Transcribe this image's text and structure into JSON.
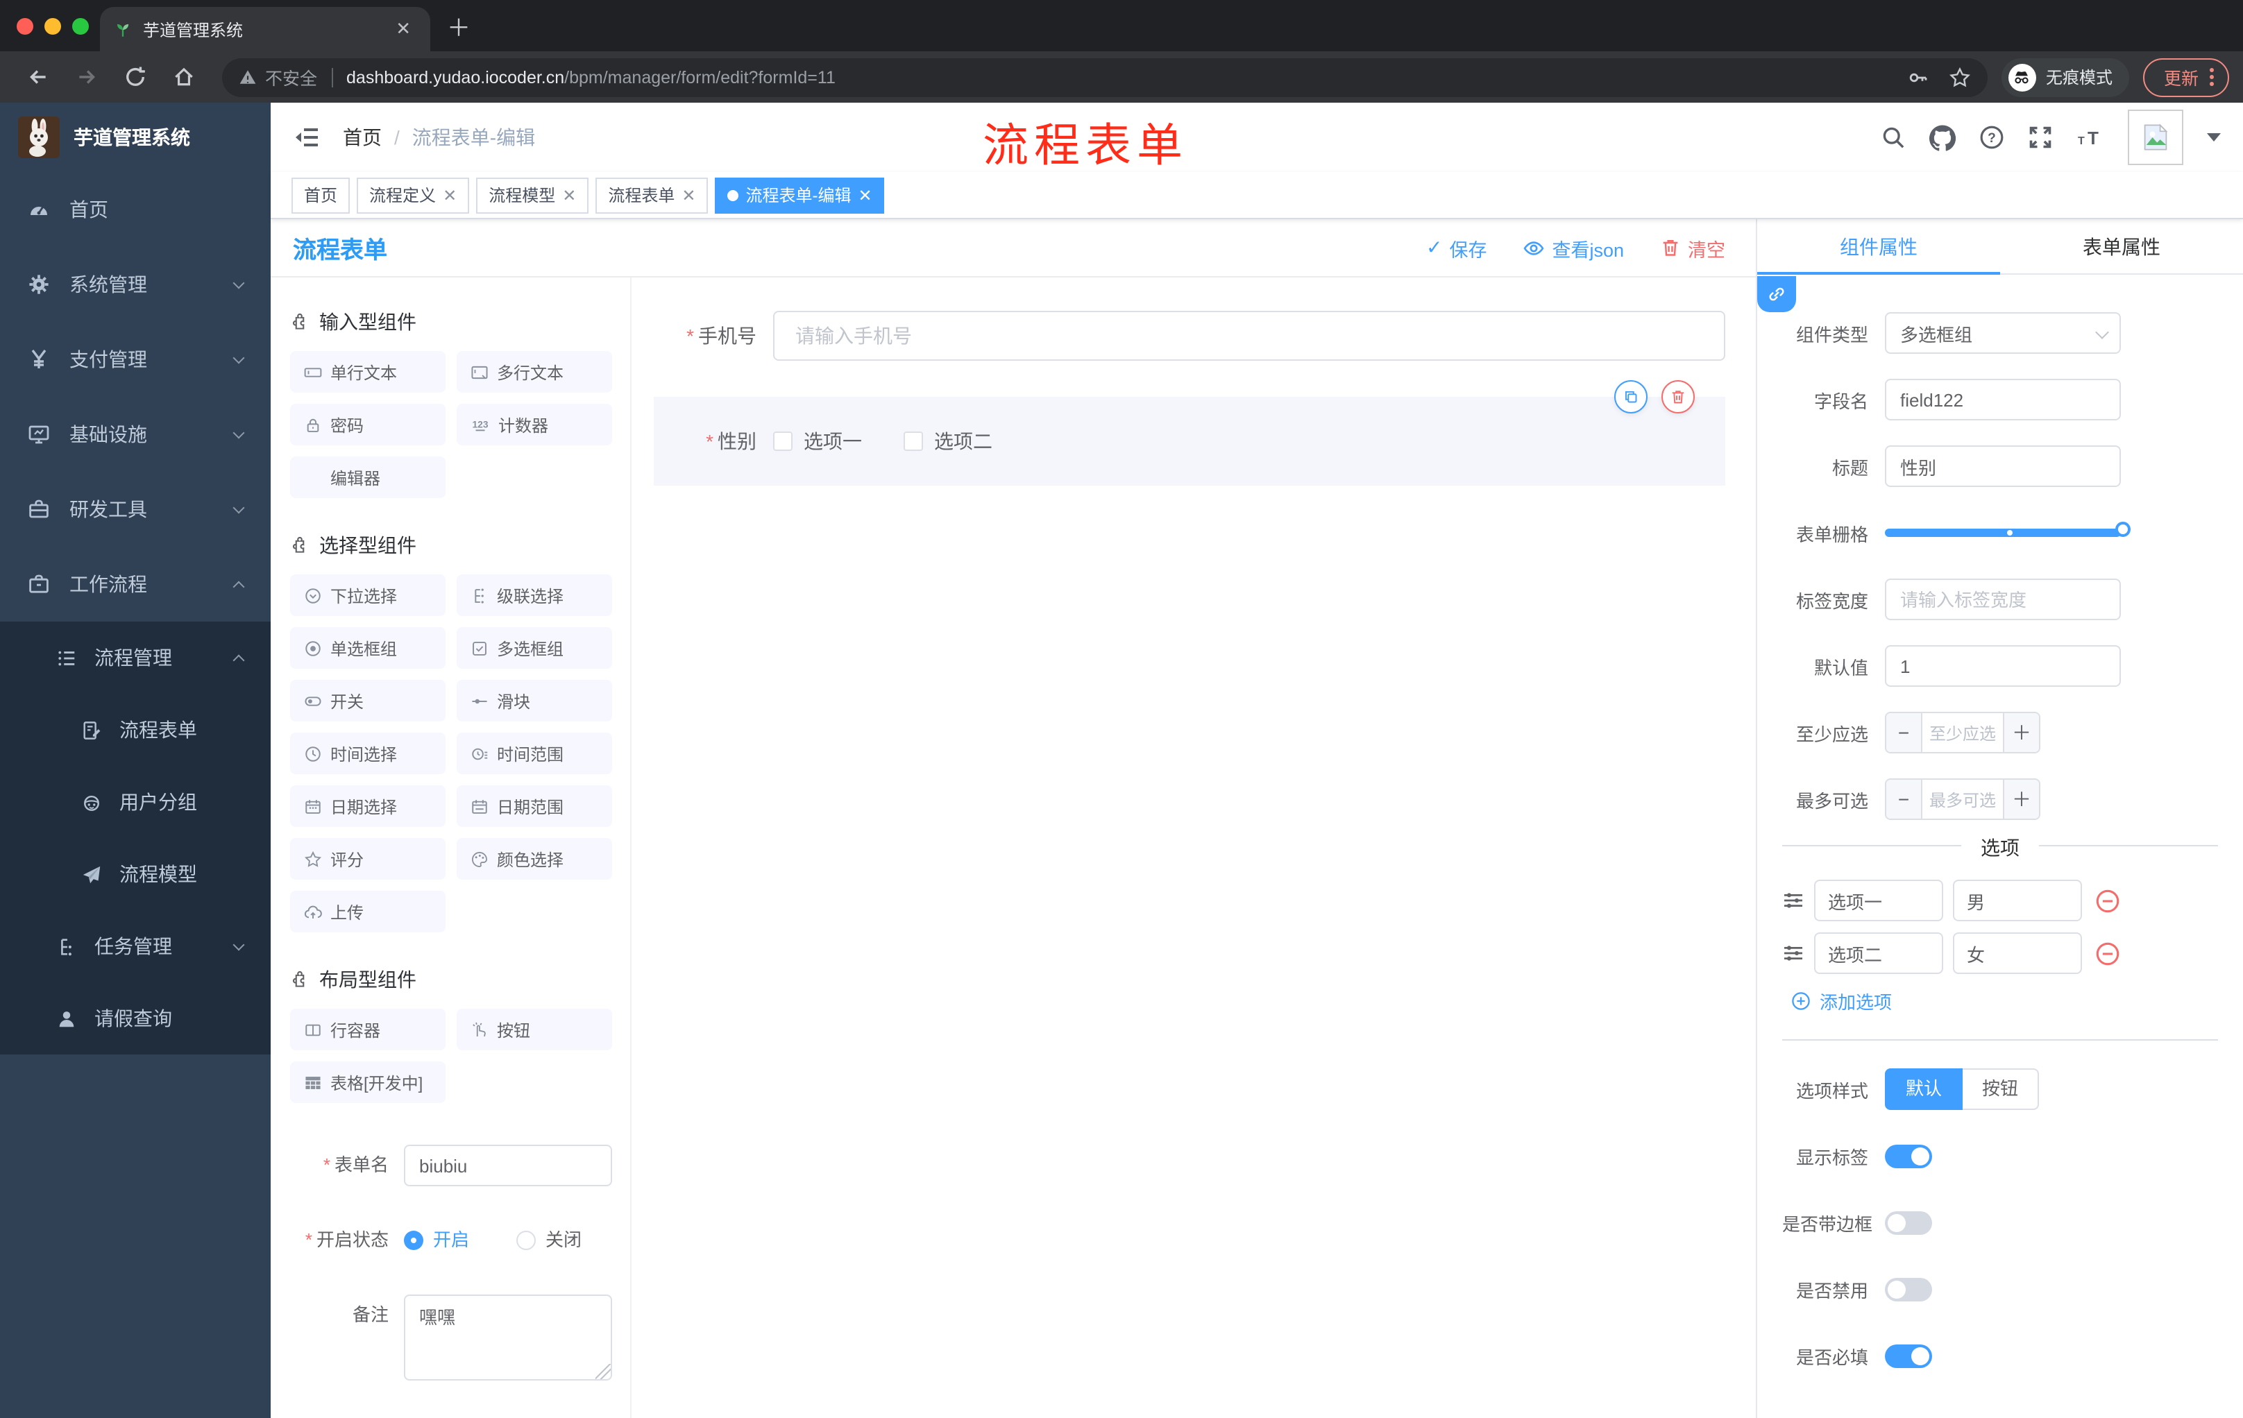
{
  "browser": {
    "tab_title": "芋道管理系统",
    "security_label": "不安全",
    "url_domain": "dashboard.yudao.iocoder.cn",
    "url_path": "/bpm/manager/form/edit?formId=11",
    "incognito_label": "无痕模式",
    "update_label": "更新"
  },
  "sidebar": {
    "brand": "芋道管理系统",
    "items": [
      {
        "label": "首页"
      },
      {
        "label": "系统管理"
      },
      {
        "label": "支付管理"
      },
      {
        "label": "基础设施"
      },
      {
        "label": "研发工具"
      },
      {
        "label": "工作流程"
      }
    ],
    "process_menu": {
      "label": "流程管理",
      "children": [
        {
          "label": "流程表单"
        },
        {
          "label": "用户分组"
        },
        {
          "label": "流程模型"
        }
      ]
    },
    "task_menu": {
      "label": "任务管理"
    },
    "leave_item": {
      "label": "请假查询"
    }
  },
  "header": {
    "breadcrumb_home": "首页",
    "breadcrumb_current": "流程表单-编辑"
  },
  "annotation": {
    "text": "流程表单"
  },
  "tags": {
    "items": [
      {
        "label": "首页"
      },
      {
        "label": "流程定义"
      },
      {
        "label": "流程模型"
      },
      {
        "label": "流程表单"
      },
      {
        "label": "流程表单-编辑"
      }
    ]
  },
  "designer": {
    "title": "流程表单",
    "save_label": "保存",
    "view_json_label": "查看json",
    "clear_label": "清空"
  },
  "components": {
    "groups": [
      {
        "title": "输入型组件",
        "items": [
          "单行文本",
          "多行文本",
          "密码",
          "计数器",
          "编辑器"
        ]
      },
      {
        "title": "选择型组件",
        "items": [
          "下拉选择",
          "级联选择",
          "单选框组",
          "多选框组",
          "开关",
          "滑块",
          "时间选择",
          "时间范围",
          "日期选择",
          "日期范围",
          "评分",
          "颜色选择",
          "上传"
        ]
      },
      {
        "title": "布局型组件",
        "items": [
          "行容器",
          "按钮",
          "表格[开发中]"
        ]
      }
    ]
  },
  "form_meta": {
    "name_label": "表单名",
    "name_value": "biubiu",
    "status_label": "开启状态",
    "on_label": "开启",
    "off_label": "关闭",
    "remark_label": "备注",
    "remark_value": "嘿嘿"
  },
  "canvas": {
    "phone_label": "手机号",
    "phone_placeholder": "请输入手机号",
    "gender_label": "性别",
    "options": [
      "选项一",
      "选项二"
    ]
  },
  "props": {
    "tab_component": "组件属性",
    "tab_form": "表单属性",
    "type_label": "组件类型",
    "type_value": "多选框组",
    "field_label": "字段名",
    "field_value": "field122",
    "title_label": "标题",
    "title_value": "性别",
    "grid_label": "表单栅格",
    "label_width_label": "标签宽度",
    "label_width_placeholder": "请输入标签宽度",
    "default_label": "默认值",
    "default_value": "1",
    "min_label": "至少应选",
    "min_placeholder": "至少应选",
    "max_label": "最多可选",
    "max_placeholder": "最多可选",
    "options_title": "选项",
    "options": [
      {
        "label": "选项一",
        "value": "男"
      },
      {
        "label": "选项二",
        "value": "女"
      }
    ],
    "add_option_label": "添加选项",
    "style_label": "选项样式",
    "style_options": [
      "默认",
      "按钮"
    ],
    "switches": [
      {
        "label": "显示标签"
      },
      {
        "label": "是否带边框"
      },
      {
        "label": "是否禁用"
      },
      {
        "label": "是否必填"
      }
    ]
  }
}
